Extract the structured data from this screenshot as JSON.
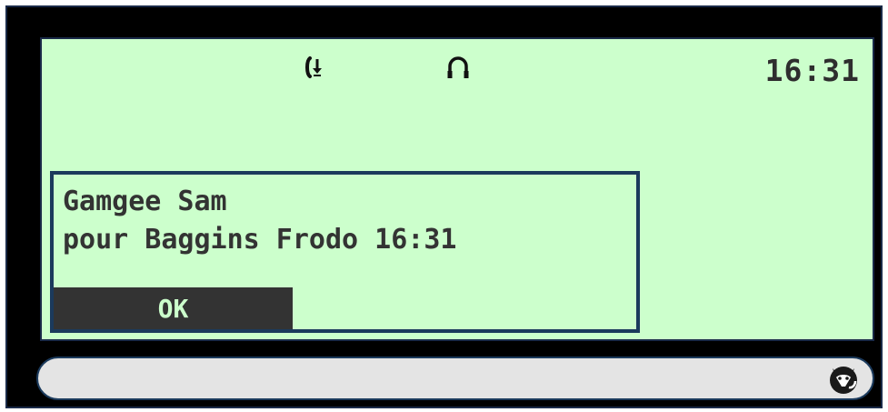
{
  "status_bar": {
    "icons": [
      "call-forward-icon",
      "headset-icon"
    ],
    "time": "16:31"
  },
  "dialog": {
    "caller": "Gamgee Sam",
    "message": "pour Baggins Frodo 16:31",
    "ok_label": "OK"
  },
  "bottom_bar": {
    "icon": "fox-head-icon"
  },
  "colors": {
    "screen_bg": "#ccffcc",
    "frame": "#000000",
    "border": "#1b3a5c",
    "text": "#333333",
    "button_bg": "#333333",
    "bar_bg": "#e4e4e4"
  }
}
